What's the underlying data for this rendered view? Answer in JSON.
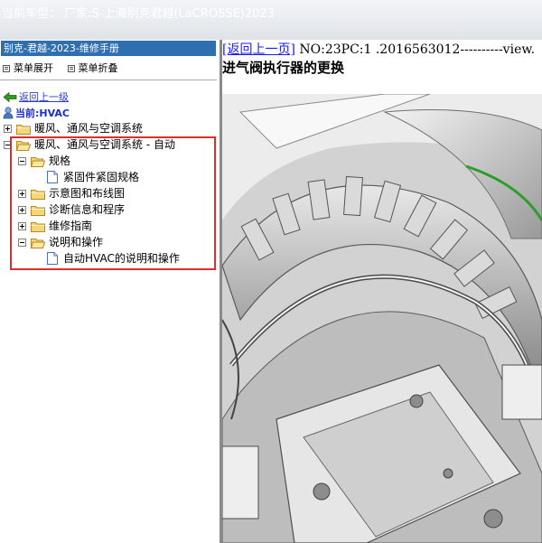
{
  "app": {
    "title_bar": "当前车型： 厂家:S-上海别克君越(LaCROSSE)2023"
  },
  "sidebar": {
    "panel_title": "别克-君越-2023-维修手册",
    "menu": {
      "expand_label": "菜单展开",
      "collapse_label": "菜单折叠"
    },
    "back_link": "返回上一级",
    "current_label": "当前:HVAC",
    "tree": [
      {
        "label": "暖风、通风与空调系统",
        "level": 0,
        "type": "folder",
        "toggle": "plus"
      },
      {
        "label": "暖风、通风与空调系统 - 自动",
        "level": 0,
        "type": "folder-open",
        "toggle": "minus"
      },
      {
        "label": "规格",
        "level": 1,
        "type": "folder-open",
        "toggle": "minus"
      },
      {
        "label": "紧固件紧固规格",
        "level": 2,
        "type": "doc",
        "toggle": "none"
      },
      {
        "label": "示意图和布线图",
        "level": 1,
        "type": "folder",
        "toggle": "plus"
      },
      {
        "label": "诊断信息和程序",
        "level": 1,
        "type": "folder",
        "toggle": "plus"
      },
      {
        "label": "维修指南",
        "level": 1,
        "type": "folder",
        "toggle": "plus"
      },
      {
        "label": "说明和操作",
        "level": 1,
        "type": "folder-open",
        "toggle": "minus"
      },
      {
        "label": "自动HVAC的说明和操作",
        "level": 2,
        "type": "doc",
        "toggle": "none"
      }
    ]
  },
  "content": {
    "back_link": "[返回上一页]",
    "doc_ref": "NO:23PC:1 .2016563012----------view.",
    "heading": "进气阀执行器的更换",
    "figure_icon": "hvac-blower-assembly-illustration"
  },
  "colors": {
    "panel_title_bg": "#2f6fb0",
    "highlight_border": "#d92f2f",
    "link": "#1a1aff",
    "current": "#1a2fd0"
  }
}
